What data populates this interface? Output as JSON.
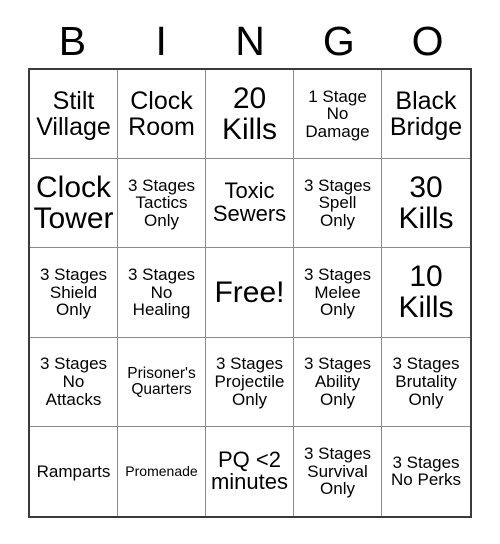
{
  "card": {
    "header_letters": [
      "B",
      "I",
      "N",
      "G",
      "O"
    ],
    "free_space_label": "Free!",
    "columns": 5,
    "rows": 5,
    "colors": {
      "cell_background": "#ffffff",
      "page_background": "#ffffff",
      "text": "#000000",
      "inner_border": "#8c8c8c",
      "outer_border": "#3a3a3a"
    },
    "cells": [
      {
        "text": "Stilt\nVillage",
        "size": "lg"
      },
      {
        "text": "Clock\nRoom",
        "size": "lg"
      },
      {
        "text": "20\nKills",
        "size": "xl"
      },
      {
        "text": "1 Stage\nNo\nDamage",
        "size": "sm"
      },
      {
        "text": "Black\nBridge",
        "size": "lg"
      },
      {
        "text": "Clock\nTower",
        "size": "xl"
      },
      {
        "text": "3 Stages\nTactics\nOnly",
        "size": "sm"
      },
      {
        "text": "Toxic\nSewers",
        "size": "md"
      },
      {
        "text": "3 Stages\nSpell\nOnly",
        "size": "sm"
      },
      {
        "text": "30\nKills",
        "size": "xl"
      },
      {
        "text": "3 Stages\nShield\nOnly",
        "size": "sm"
      },
      {
        "text": "3 Stages\nNo\nHealing",
        "size": "sm"
      },
      {
        "text": "Free!",
        "size": "xl"
      },
      {
        "text": "3 Stages\nMelee\nOnly",
        "size": "sm"
      },
      {
        "text": "10\nKills",
        "size": "xl"
      },
      {
        "text": "3 Stages\nNo\nAttacks",
        "size": "sm"
      },
      {
        "text": "Prisoner's\nQuarters",
        "size": "xs"
      },
      {
        "text": "3 Stages\nProjectile\nOnly",
        "size": "sm"
      },
      {
        "text": "3 Stages\nAbility\nOnly",
        "size": "sm"
      },
      {
        "text": "3 Stages\nBrutality\nOnly",
        "size": "sm"
      },
      {
        "text": "Ramparts",
        "size": "sm"
      },
      {
        "text": "Promenade",
        "size": "xxs"
      },
      {
        "text": "PQ <2\nminutes",
        "size": "md"
      },
      {
        "text": "3 Stages\nSurvival\nOnly",
        "size": "sm"
      },
      {
        "text": "3 Stages\nNo Perks",
        "size": "sm"
      }
    ]
  }
}
